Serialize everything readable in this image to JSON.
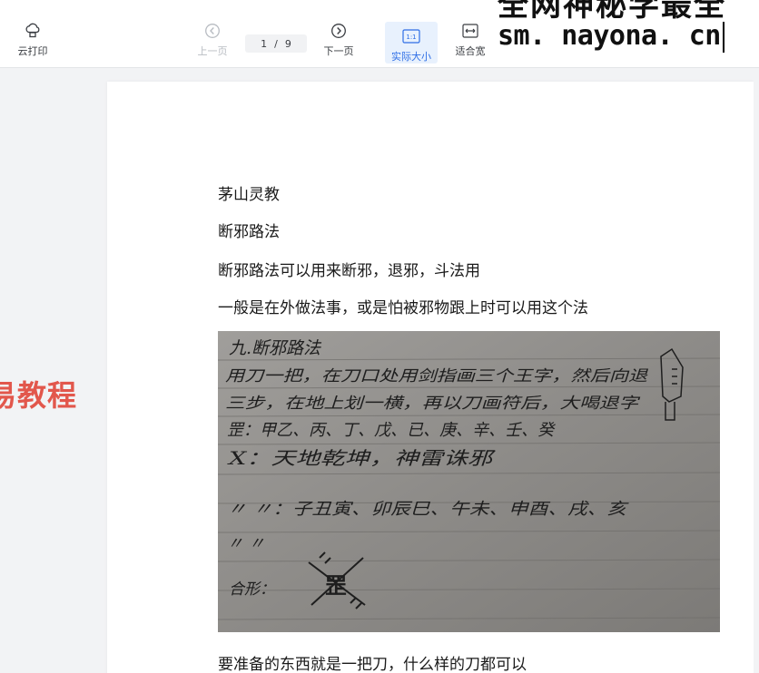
{
  "toolbar": {
    "print_label": "云打印",
    "prev_label": "上一页",
    "next_label": "下一页",
    "current_page": "1",
    "page_separator": "/",
    "total_pages": "9",
    "actual_size_label": "实际大小",
    "actual_size_icon_text": "1:1",
    "fit_width_label": "适合宽"
  },
  "watermark": {
    "top_text": "全网神秘学最全",
    "url_text": "sm. nayona. cn"
  },
  "side_text": "易教程",
  "document": {
    "lines": [
      "茅山灵教",
      "断邪路法",
      "断邪路法可以用来断邪，退邪，斗法用",
      "一般是在外做法事，或是怕被邪物跟上时可以用这个法"
    ],
    "bottom_line": "要准备的东西就是一把刀，什么样的刀都可以"
  },
  "handwriting": {
    "line1": "九.断邪路法",
    "line2": "用刀一把，在刀口处用剑指画三个王字，然后向退",
    "line3": "三步，在地上划一横，再以刀画符后，大喝退字",
    "line4": "罡：甲乙、丙、丁、戊、已、庚、辛、壬、癸",
    "line5": "X：天地乾坤，神雷诛邪",
    "line6": "〃 〃：子丑寅、卯辰巳、午未、申酉、戌、亥",
    "line7": "〃 〃",
    "line8": "合形：",
    "glyph": "罡"
  }
}
